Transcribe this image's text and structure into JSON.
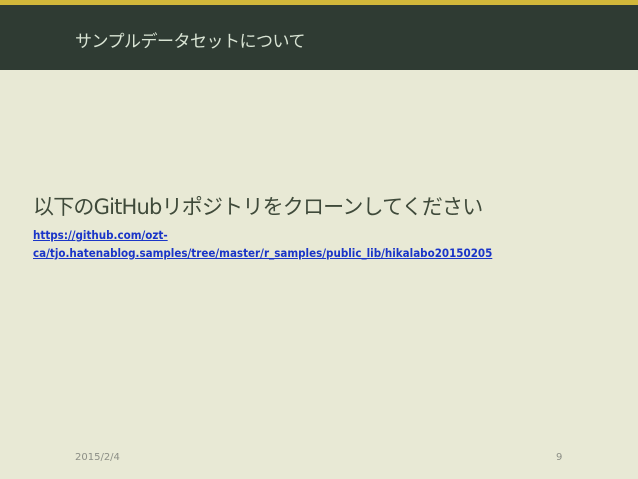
{
  "slide": {
    "title": "サンプルデータセットについて",
    "heading": "以下のGitHubリポジトリをクローンしてください",
    "link_line1": "https://github.com/ozt-",
    "link_line2": "ca/tjo.hatenablog.samples/tree/master/r_samples/public_lib/hikalabo20150205",
    "date": "2015/2/4",
    "page_number": "9"
  },
  "colors": {
    "header_bg": "#2f3b33",
    "accent": "#d2b73a",
    "slide_bg": "#e8e9d5",
    "link": "#1a35c8"
  }
}
